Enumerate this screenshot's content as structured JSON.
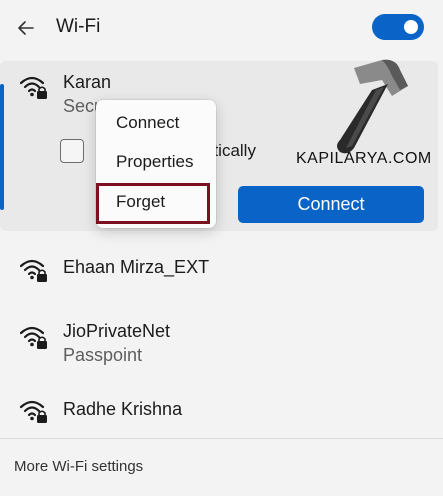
{
  "header": {
    "title": "Wi-Fi",
    "back_icon": "arrow-left-icon",
    "toggle_state": "on",
    "accent_color": "#0a63c7"
  },
  "selected_network": {
    "name": "Karan",
    "status_partial": "Secu",
    "auto_connect_label_partial": "atically",
    "auto_connect_checked": false,
    "connect_label": "Connect",
    "icon": "wifi-secured-icon"
  },
  "context_menu": {
    "items": [
      {
        "label": "Connect"
      },
      {
        "label": "Properties"
      },
      {
        "label": "Forget"
      }
    ],
    "highlighted_item": "Forget",
    "highlight_color": "#7b1020"
  },
  "logo": {
    "text": "KAPILARYA.COM",
    "icon": "hammer-icon"
  },
  "networks": [
    {
      "name": "Ehaan Mirza_EXT",
      "subtitle": "",
      "icon": "wifi-secured-icon"
    },
    {
      "name": "JioPrivateNet",
      "subtitle": "Passpoint",
      "icon": "wifi-secured-icon"
    },
    {
      "name": "Radhe Krishna",
      "subtitle": "",
      "icon": "wifi-secured-icon"
    }
  ],
  "footer": {
    "more_settings_label": "More Wi-Fi settings"
  }
}
